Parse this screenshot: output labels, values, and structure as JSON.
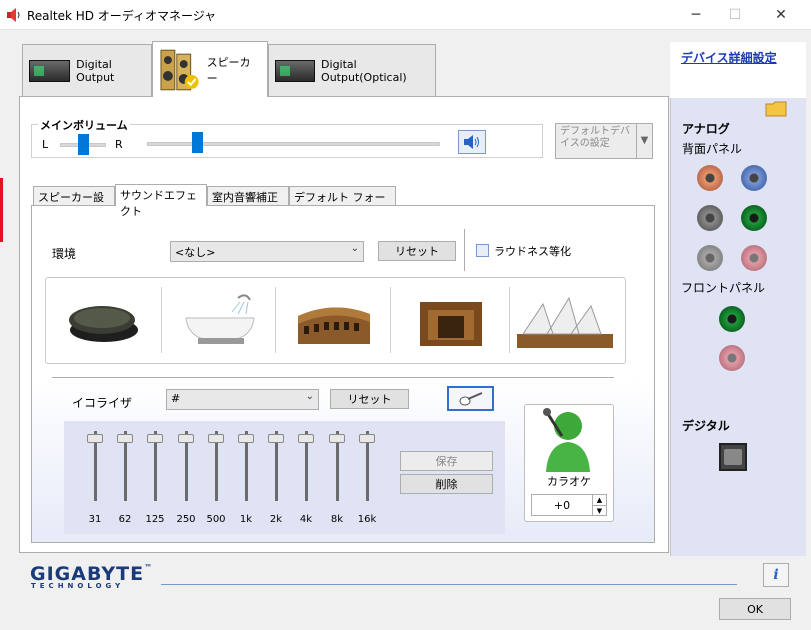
{
  "window": {
    "title": "Realtek HD オーディオマネージャ"
  },
  "device_tabs": [
    {
      "label": "Digital Output"
    },
    {
      "label": "スピーカー"
    },
    {
      "label": "Digital Output(Optical)"
    }
  ],
  "main_volume": {
    "label": "メインボリューム",
    "left": "L",
    "right": "R",
    "balance": 0.5,
    "level": 0.17
  },
  "default_device": {
    "label": "デフォルトデバイスの設定"
  },
  "sub_tabs": [
    {
      "label": "スピーカー設定"
    },
    {
      "label": "サウンドエフェクト"
    },
    {
      "label": "室内音響補正"
    },
    {
      "label": "デフォルト フォーマット"
    }
  ],
  "environment": {
    "label": "環境",
    "value": "<なし>",
    "reset": "リセット",
    "loudness": "ラウドネス等化",
    "loudness_checked": false,
    "presets": [
      "stone-disc",
      "bathtub",
      "colosseum",
      "stone-room",
      "opera-house"
    ]
  },
  "equalizer": {
    "label": "イコライザ",
    "value": "#",
    "reset": "リセット",
    "save": "保存",
    "delete": "削除",
    "bands": [
      {
        "freq": "31",
        "level": 0
      },
      {
        "freq": "62",
        "level": 0
      },
      {
        "freq": "125",
        "level": 0
      },
      {
        "freq": "250",
        "level": 0
      },
      {
        "freq": "500",
        "level": 0
      },
      {
        "freq": "1k",
        "level": 0
      },
      {
        "freq": "2k",
        "level": 0
      },
      {
        "freq": "4k",
        "level": 0
      },
      {
        "freq": "8k",
        "level": 0
      },
      {
        "freq": "16k",
        "level": 0
      }
    ]
  },
  "karaoke": {
    "label": "カラオケ",
    "value": "+0"
  },
  "sidebar": {
    "device_settings_link": "デバイス詳細設定",
    "analog": "アナログ",
    "rear_panel": "背面パネル",
    "front_panel": "フロントパネル",
    "digital": "デジタル",
    "colors": {
      "orange": "#e8956b",
      "blue": "#7896d6",
      "gray": "#8a8a8a",
      "green": "#1e9a3a",
      "gray_light": "#a6a6a6",
      "pink": "#e39aa6"
    }
  },
  "brand": {
    "name": "GIGABYTE",
    "tm": "™",
    "sub": "TECHNOLOGY"
  },
  "footer": {
    "ok": "OK"
  }
}
